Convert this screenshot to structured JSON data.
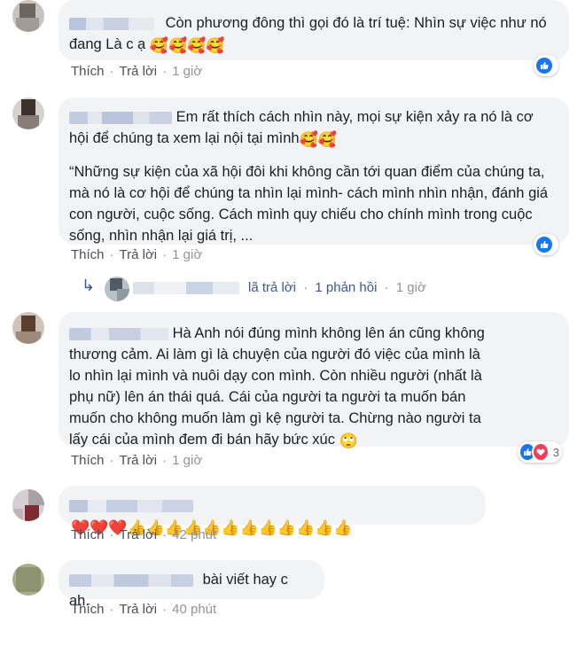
{
  "actions": {
    "like": "Thích",
    "reply": "Trả lời",
    "separator": "·"
  },
  "comments": [
    {
      "text": "Còn phương đông thì gọi đó là trí tuệ: Nhìn sự việc như nó đang Là c ạ",
      "emojis": "🥰🥰🥰🥰",
      "time": "1 giờ",
      "reaction_count": ""
    },
    {
      "text_line1": "Em rất thích cách nhìn này, mọi sự kiện xảy ra nó là cơ",
      "text_line2": "hội để chúng ta xem lại nội tại mình",
      "emojis": "🥰🥰",
      "quote": "“Những sự kiện của xã hội đôi khi không cần tới quan điểm của chúng ta, mà nó là cơ hội để chúng ta nhìn lại mình- cách mình nhìn nhận, đánh giá con người, cuộc sống. Cách mình quy chiếu cho chính mình trong cuộc sống, nhìn nhận lại giá trị, ...",
      "time": "1 giờ",
      "reaction_count": ""
    },
    {
      "text": "Hà Anh nói đúng mình không lên án cũng không thương cảm. Ai làm gì là chuyện của người đó việc của mình là lo nhìn lại mình và nuôi dạy con mình. Còn nhiều người (nhất là phụ nữ) lên án thái quá. Cái của người ta người ta muốn bán muốn cho không muốn làm gì kệ người ta. Chừng nào người ta lấy cái của mình đem đi bán hãy bức xúc",
      "emojis": "🙄",
      "time": "1 giờ",
      "reaction_count": "3"
    },
    {
      "emojis": "❤️❤️❤️👍👍👍👍👍👍👍👍👍👍👍👍",
      "time": "42 phút"
    },
    {
      "text": "bài viết hay c ah.",
      "time": "40 phút"
    }
  ],
  "reply_summary": {
    "arrow": "↳",
    "text": "lã trả lời",
    "count": "1 phản hồi",
    "time": "1 giờ"
  },
  "colors": {
    "like_blue": "#1877f2",
    "love_red": "#f33e58",
    "bubble": "#f2f3f5",
    "link": "#385898"
  },
  "icons": [
    "like-icon",
    "love-icon",
    "reply-arrow-icon"
  ]
}
